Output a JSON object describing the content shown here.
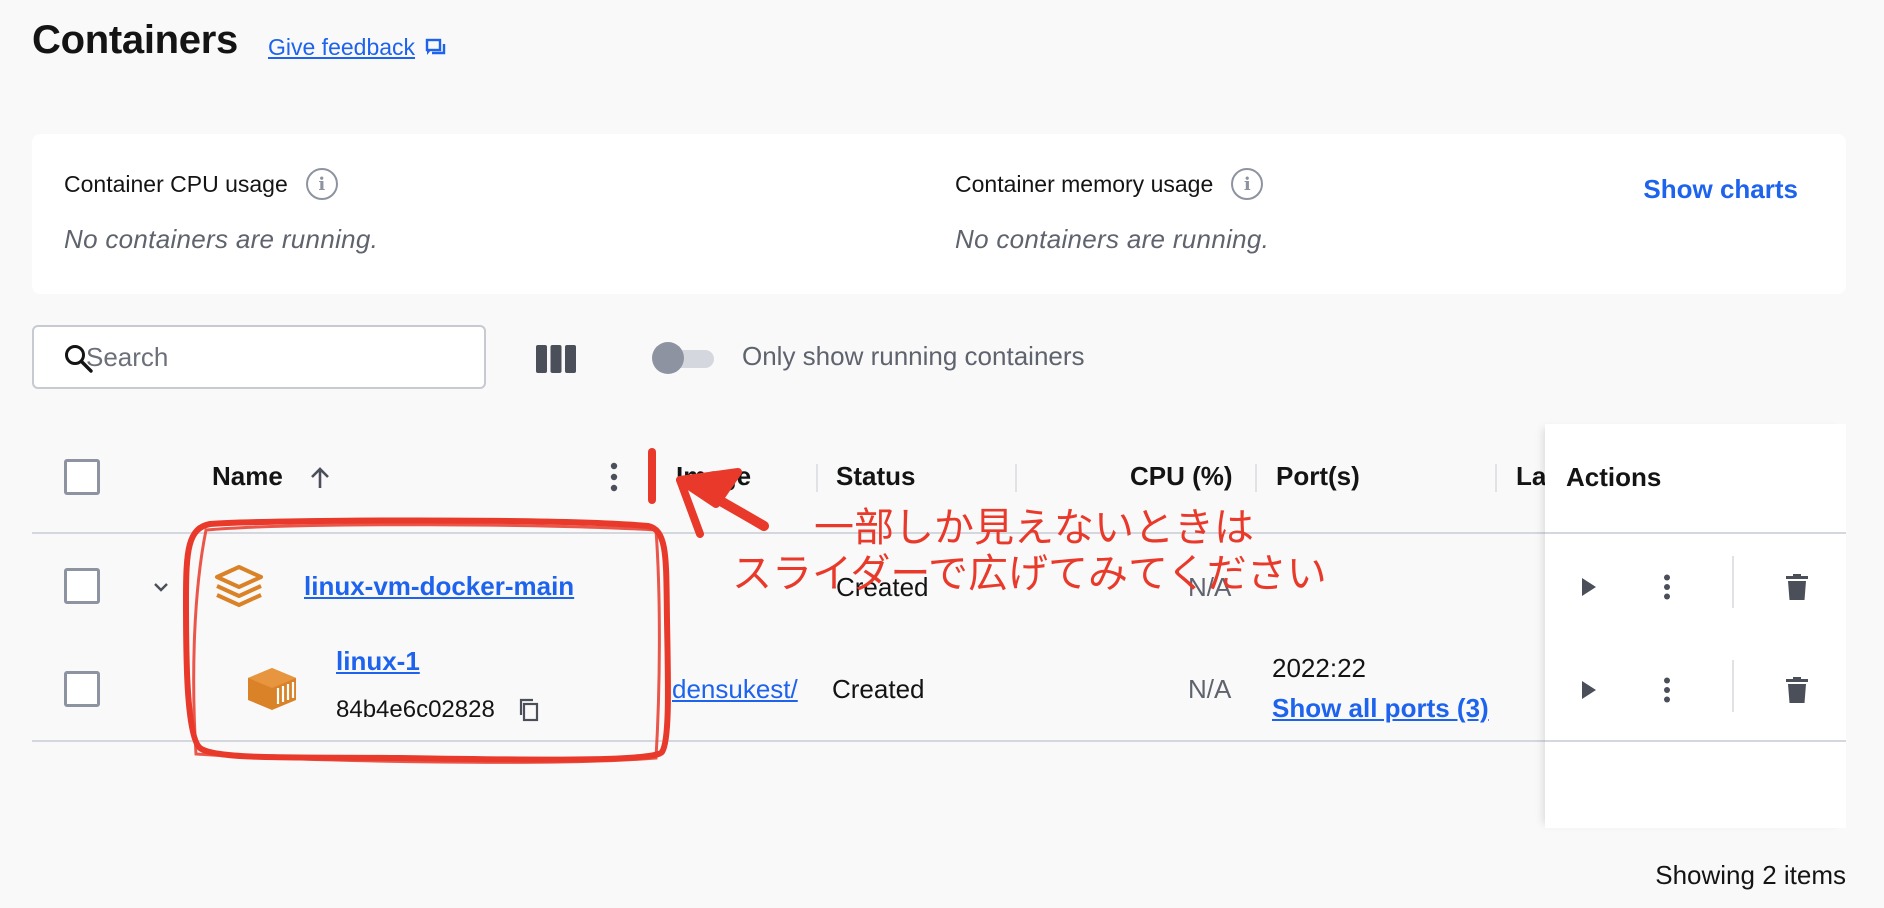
{
  "header": {
    "title": "Containers",
    "feedback_label": "Give feedback"
  },
  "stats": {
    "cpu_label": "Container CPU usage",
    "cpu_empty": "No containers are running.",
    "memory_label": "Container memory usage",
    "memory_empty": "No containers are running.",
    "show_charts_label": "Show charts"
  },
  "toolbar": {
    "search_placeholder": "Search",
    "toggle_label": "Only show running containers",
    "toggle_on": false
  },
  "table": {
    "columns": {
      "name": "Name",
      "image": "Image",
      "status": "Status",
      "cpu": "CPU (%)",
      "ports": "Port(s)",
      "last": "La",
      "actions": "Actions"
    },
    "rows": [
      {
        "name": "linux-vm-docker-main",
        "type": "compose-group",
        "image": "",
        "status": "Created",
        "cpu": "N/A",
        "ports": ""
      },
      {
        "name": "linux-1",
        "type": "container",
        "id": "84b4e6c02828",
        "image": "densukest/",
        "status": "Created",
        "cpu": "N/A",
        "ports": "2022:22",
        "ports_link": "Show all ports (3)"
      }
    ]
  },
  "footer": {
    "showing": "Showing 2 items"
  },
  "annotation": {
    "line1": "一部しか見えないときは",
    "line2": "スライダーで広げてみてください",
    "color": "#e8392a"
  },
  "colors": {
    "accent": "#1d63ed",
    "compose_icon": "#d98227",
    "background": "#f9f9f9"
  }
}
